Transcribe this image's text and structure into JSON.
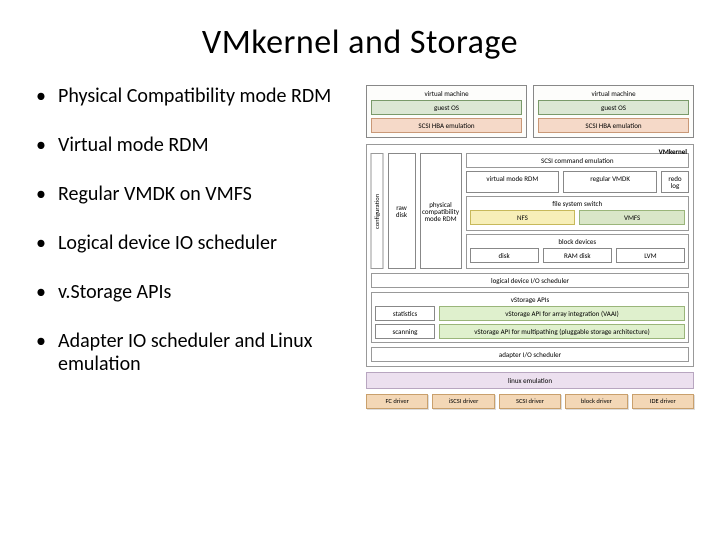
{
  "title": "VMkernel and Storage",
  "bullets": {
    "b0": "Physical Compatibility mode RDM",
    "b1": "Virtual mode RDM",
    "b2": "Regular VMDK on VMFS",
    "b3": "Logical device IO scheduler",
    "b4": "v.Storage APIs",
    "b5": "Adapter IO scheduler and Linux emulation"
  },
  "diagram": {
    "vm_caption": "virtual machine",
    "guest_os": "guest OS",
    "scsi_emulation": "SCSI HBA emulation",
    "vmkernel_label": "VMkernel",
    "configuration": "configuration",
    "raw_disk": "raw disk",
    "phys_rdm": "physical compatibility mode RDM",
    "scsi_cmd_emulation": "SCSI command emulation",
    "virtual_mode_rdm": "virtual mode RDM",
    "regular_vmdk": "regular VMDK",
    "redo_log": "redo log",
    "file_system_switch": "file system switch",
    "nfs": "NFS",
    "vmfs": "VMFS",
    "block_devices": "block devices",
    "disk": "disk",
    "ram_disk": "RAM disk",
    "lvm": "LVM",
    "logical_sched": "logical device I/O scheduler",
    "vstorage_apis": "vStorage APIs",
    "statistics": "statistics",
    "scanning": "scanning",
    "vaai": "vStorage API for array integration (VAAI)",
    "multipathing": "vStorage API for multipathing (pluggable storage architecture)",
    "adapter_sched": "adapter I/O scheduler",
    "linux_emulation": "linux emulation",
    "drv_fc": "FC driver",
    "drv_iscsi": "iSCSI driver",
    "drv_scsi": "SCSI driver",
    "drv_block": "block driver",
    "drv_ide": "IDE driver"
  }
}
